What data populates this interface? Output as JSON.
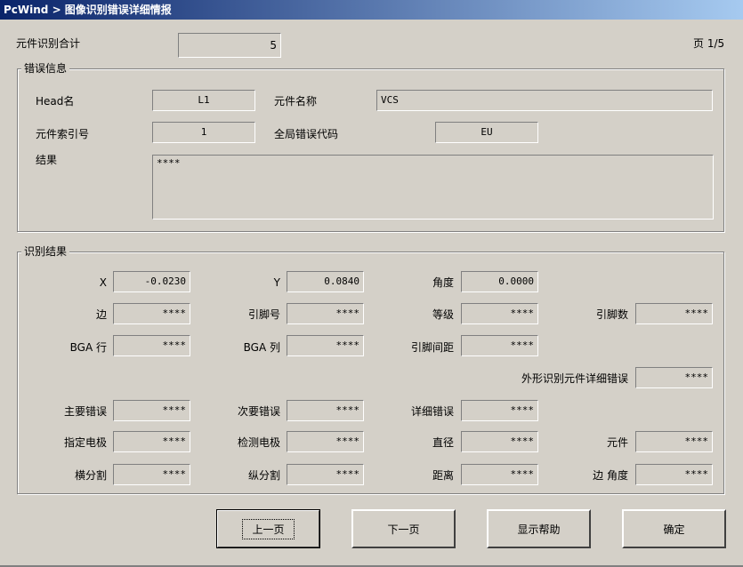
{
  "window": {
    "title": "PcWind > 图像识别错误详细情报"
  },
  "summary": {
    "total_label": "元件识别合计",
    "total_value": "5",
    "page_label": "页 1/5"
  },
  "error_info": {
    "title": "错误信息",
    "head_label": "Head名",
    "head_value": "L1",
    "part_name_label": "元件名称",
    "part_name_value": "VCS",
    "part_index_label": "元件索引号",
    "part_index_value": "1",
    "global_code_label": "全局错误代码",
    "global_code_value": "EU",
    "result_label": "结果",
    "result_value": "****"
  },
  "recog": {
    "title": "识别结果",
    "x_label": "X",
    "x_value": "-0.0230",
    "y_label": "Y",
    "y_value": "0.0840",
    "angle_label": "角度",
    "angle_value": "0.0000",
    "edge_label": "边",
    "edge_value": "****",
    "pin_no_label": "引脚号",
    "pin_no_value": "****",
    "grade_label": "等级",
    "grade_value": "****",
    "pin_count_label": "引脚数",
    "pin_count_value": "****",
    "bga_row_label": "BGA 行",
    "bga_row_value": "****",
    "bga_col_label": "BGA 列",
    "bga_col_value": "****",
    "pin_pitch_label": "引脚间距",
    "pin_pitch_value": "****",
    "shape_err_label": "外形识别元件详细错误",
    "shape_err_value": "****",
    "main_err_label": "主要错误",
    "main_err_value": "****",
    "sub_err_label": "次要错误",
    "sub_err_value": "****",
    "detail_err_label": "详细错误",
    "detail_err_value": "****",
    "spec_elec_label": "指定电极",
    "spec_elec_value": "****",
    "detect_elec_label": "检测电极",
    "detect_elec_value": "****",
    "diameter_label": "直径",
    "diameter_value": "****",
    "part_label": "元件",
    "part_value": "****",
    "hsplit_label": "横分割",
    "hsplit_value": "****",
    "vsplit_label": "纵分割",
    "vsplit_value": "****",
    "distance_label": "距离",
    "distance_value": "****",
    "edge_angle_label": "边 角度",
    "edge_angle_value": "****"
  },
  "buttons": {
    "prev": "上一页",
    "next": "下一页",
    "help": "显示帮助",
    "ok": "确定"
  }
}
